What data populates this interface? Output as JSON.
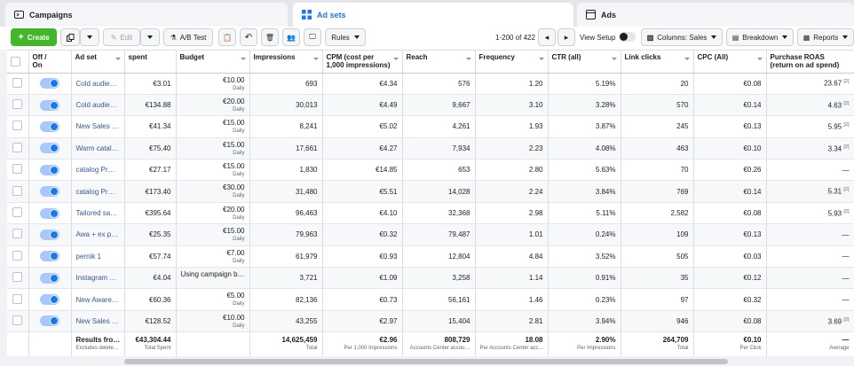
{
  "tabs": [
    {
      "label": "Campaigns",
      "icon": "folder-icon"
    },
    {
      "label": "Ad sets",
      "icon": "grid-icon",
      "active": true
    },
    {
      "label": "Ads",
      "icon": "document-icon"
    }
  ],
  "toolbar": {
    "create": "Create",
    "edit": "Edit",
    "ab_test": "A/B Test",
    "rules": "Rules",
    "pagination": "1-200 of 422",
    "view_setup": "View Setup",
    "columns": "Columns: Sales",
    "breakdown": "Breakdown",
    "reports": "Reports"
  },
  "columns": {
    "offon_1": "Off /",
    "offon_2": "On",
    "adset": "Ad set",
    "spent": "spent",
    "budget": "Budget",
    "impressions": "Impressions",
    "cpm_1": "CPM (cost per",
    "cpm_2": "1,000 impressions)",
    "reach": "Reach",
    "frequency": "Frequency",
    "ctr": "CTR (all)",
    "link_clicks": "Link clicks",
    "cpc": "CPC (All)",
    "roas_1": "Purchase ROAS",
    "roas_2": "(return on ad spend)"
  },
  "rows": [
    {
      "name": "Cold audie…",
      "spent": "€3.01",
      "budget": "€10.00",
      "budget_sub": "Daily",
      "impressions": "693",
      "cpm": "€4.34",
      "reach": "576",
      "frequency": "1.20",
      "ctr": "5.19%",
      "link_clicks": "20",
      "cpc": "€0.08",
      "roas": "23.67",
      "roas_note": "[2]"
    },
    {
      "name": "Cold audie…",
      "spent": "€134.88",
      "budget": "€20.00",
      "budget_sub": "Daily",
      "impressions": "30,013",
      "cpm": "€4.49",
      "reach": "9,667",
      "frequency": "3.10",
      "ctr": "3.28%",
      "link_clicks": "570",
      "cpc": "€0.14",
      "roas": "4.63",
      "roas_note": "[2]"
    },
    {
      "name": "New Sales …",
      "spent": "€41.34",
      "budget": "€15.00",
      "budget_sub": "Daily",
      "impressions": "8,241",
      "cpm": "€5.02",
      "reach": "4,261",
      "frequency": "1.93",
      "ctr": "3.87%",
      "link_clicks": "245",
      "cpc": "€0.13",
      "roas": "5.95",
      "roas_note": "[2]"
    },
    {
      "name": "Warm catal…",
      "spent": "€75.40",
      "budget": "€15.00",
      "budget_sub": "Daily",
      "impressions": "17,661",
      "cpm": "€4.27",
      "reach": "7,934",
      "frequency": "2.23",
      "ctr": "4.08%",
      "link_clicks": "463",
      "cpc": "€0.10",
      "roas": "3.34",
      "roas_note": "[2]"
    },
    {
      "name": "catalog Pr…",
      "spent": "€27.17",
      "budget": "€15.00",
      "budget_sub": "Daily",
      "impressions": "1,830",
      "cpm": "€14.85",
      "reach": "653",
      "frequency": "2.80",
      "ctr": "5.63%",
      "link_clicks": "70",
      "cpc": "€0.26",
      "roas": "—",
      "roas_note": ""
    },
    {
      "name": "catalog Pr…",
      "spent": "€173.40",
      "budget": "€30.00",
      "budget_sub": "Daily",
      "impressions": "31,480",
      "cpm": "€5.51",
      "reach": "14,028",
      "frequency": "2.24",
      "ctr": "3.84%",
      "link_clicks": "769",
      "cpc": "€0.14",
      "roas": "5.31",
      "roas_note": "[2]"
    },
    {
      "name": "Tailored sa…",
      "spent": "€395.64",
      "budget": "€20.00",
      "budget_sub": "Daily",
      "impressions": "96,463",
      "cpm": "€4.10",
      "reach": "32,368",
      "frequency": "2.98",
      "ctr": "5.11%",
      "link_clicks": "2,582",
      "cpc": "€0.08",
      "roas": "5.93",
      "roas_note": "[2]"
    },
    {
      "name": "Awa + ex p…",
      "spent": "€25.35",
      "budget": "€15.00",
      "budget_sub": "Daily",
      "impressions": "79,963",
      "cpm": "€0.32",
      "reach": "79,487",
      "frequency": "1.01",
      "ctr": "0.24%",
      "link_clicks": "109",
      "cpc": "€0.13",
      "roas": "—",
      "roas_note": ""
    },
    {
      "name": "pernik 1",
      "spent": "€57.74",
      "budget": "€7.00",
      "budget_sub": "Daily",
      "impressions": "61,979",
      "cpm": "€0.93",
      "reach": "12,804",
      "frequency": "4.84",
      "ctr": "3.52%",
      "link_clicks": "505",
      "cpc": "€0.03",
      "roas": "—",
      "roas_note": ""
    },
    {
      "name": "Instagram …",
      "spent": "€4.04",
      "budget": "Using campaign b…",
      "budget_sub": "",
      "impressions": "3,721",
      "cpm": "€1.09",
      "reach": "3,258",
      "frequency": "1.14",
      "ctr": "0.91%",
      "link_clicks": "35",
      "cpc": "€0.12",
      "roas": "—",
      "roas_note": ""
    },
    {
      "name": "New Aware…",
      "spent": "€60.36",
      "budget": "€5.00",
      "budget_sub": "Daily",
      "impressions": "82,136",
      "cpm": "€0.73",
      "reach": "56,161",
      "frequency": "1.46",
      "ctr": "0.23%",
      "link_clicks": "97",
      "cpc": "€0.32",
      "roas": "—",
      "roas_note": ""
    },
    {
      "name": "New Sales …",
      "spent": "€128.52",
      "budget": "€10.00",
      "budget_sub": "Daily",
      "impressions": "43,255",
      "cpm": "€2.97",
      "reach": "15,404",
      "frequency": "2.81",
      "ctr": "3.94%",
      "link_clicks": "946",
      "cpc": "€0.08",
      "roas": "3.69",
      "roas_note": "[2]"
    }
  ],
  "totals": {
    "name": "Results fro…",
    "name_sub": "Excludes delete…",
    "spent": "€43,304.44",
    "spent_sub": "Total Spent",
    "impressions": "14,625,459",
    "impressions_sub": "Total",
    "cpm": "€2.96",
    "cpm_sub": "Per 1,000 Impressions",
    "reach": "808,729",
    "reach_sub": "Accounts Center accou…",
    "frequency": "18.08",
    "frequency_sub": "Per Accounts Center acc…",
    "ctr": "2.90%",
    "ctr_sub": "Per Impressions",
    "link_clicks": "264,709",
    "link_clicks_sub": "Total",
    "cpc": "€0.10",
    "cpc_sub": "Per Click",
    "roas": "—",
    "roas_sub": "Average"
  },
  "colors": {
    "accent": "#1877f2",
    "create": "#42b72a",
    "link": "#385898"
  }
}
